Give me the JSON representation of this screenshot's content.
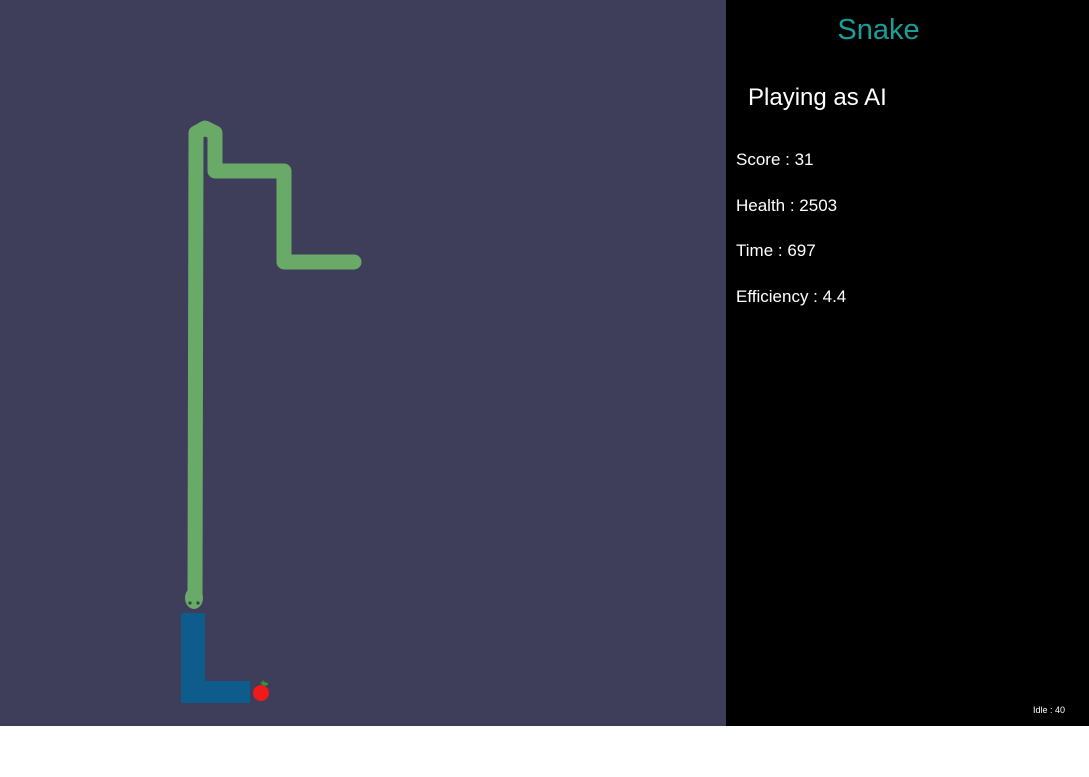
{
  "game": {
    "title": "Snake",
    "mode_label": "Playing as AI",
    "board_color": "#3e3d5a",
    "panel_color": "#000000",
    "title_color": "#1a9e9a",
    "snake_color": "#6aaa69",
    "trail_color": "#0e5c8c",
    "apple_color": "#ef1a1a"
  },
  "stats": {
    "score": "Score : 31",
    "health": "Health : 2503",
    "time": "Time : 697",
    "efficiency": "Efficiency : 4.4"
  },
  "footer": {
    "idle": "Idle : 40"
  },
  "icons": {
    "apple": "apple-icon",
    "snake_head": "snake-head-icon"
  }
}
